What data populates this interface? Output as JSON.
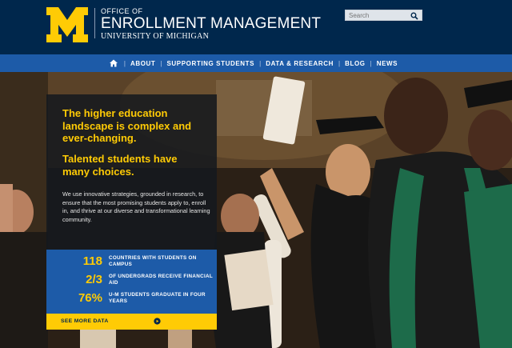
{
  "brand": {
    "office": "OFFICE OF",
    "name": "ENROLLMENT MANAGEMENT",
    "university": "UNIVERSITY OF MICHIGAN",
    "colors": {
      "navy": "#00274c",
      "maize": "#ffcb05",
      "blue": "#1d5ba8"
    }
  },
  "search": {
    "placeholder": "Search",
    "icon": "search-icon"
  },
  "nav": {
    "home_icon": "home-icon",
    "items": [
      {
        "label": "ABOUT"
      },
      {
        "label": "SUPPORTING STUDENTS"
      },
      {
        "label": "DATA & RESEARCH"
      },
      {
        "label": "BLOG"
      },
      {
        "label": "NEWS"
      }
    ]
  },
  "hero": {
    "headline1": "The higher education landscape is complex and ever-changing.",
    "headline2": "Talented students have many choices.",
    "body": "We use innovative strategies, grounded in research, to ensure that the most promising students apply to, enroll in, and thrive at our diverse and transformational learning community.",
    "stats": [
      {
        "value": "118",
        "label": "COUNTRIES WITH STUDENTS ON CAMPUS"
      },
      {
        "value": "2/3",
        "label": "OF UNDERGRADS RECEIVE FINANCIAL AID"
      },
      {
        "value": "76%",
        "label": "U-M STUDENTS GRADUATE IN FOUR YEARS"
      }
    ],
    "cta": {
      "label": "SEE MORE DATA",
      "icon": "arrow-circle-icon"
    }
  }
}
